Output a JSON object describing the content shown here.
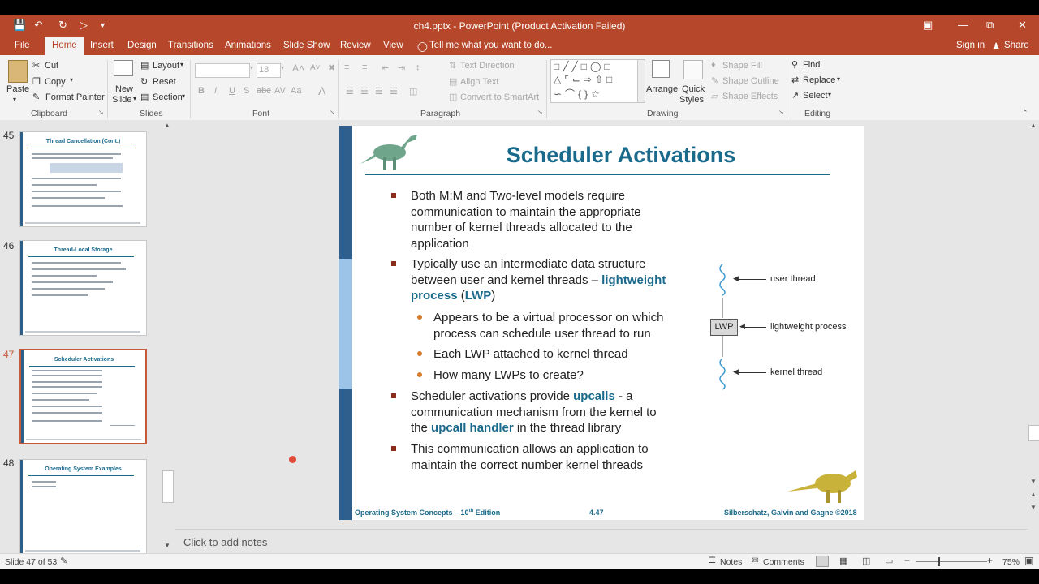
{
  "window": {
    "title": "ch4.pptx - PowerPoint (Product Activation Failed)",
    "signin": "Sign in",
    "share": "Share"
  },
  "tabs": [
    "File",
    "Home",
    "Insert",
    "Design",
    "Transitions",
    "Animations",
    "Slide Show",
    "Review",
    "View"
  ],
  "tell_me": "Tell me what you want to do...",
  "ribbon": {
    "clipboard": {
      "paste": "Paste",
      "cut": "Cut",
      "copy": "Copy",
      "format_painter": "Format Painter",
      "group": "Clipboard"
    },
    "slides": {
      "new_slide": "New",
      "new_slide2": "Slide",
      "layout": "Layout",
      "reset": "Reset",
      "section": "Section",
      "group": "Slides"
    },
    "font": {
      "size": "18",
      "group": "Font",
      "bold": "B",
      "italic": "I",
      "underline": "U",
      "strike": "S",
      "shadow": "abc",
      "spacing": "AV",
      "case": "Aa",
      "color": "A"
    },
    "paragraph": {
      "text_direction": "Text Direction",
      "align_text": "Align Text",
      "convert": "Convert to SmartArt",
      "group": "Paragraph"
    },
    "drawing": {
      "arrange": "Arrange",
      "quick": "Quick",
      "styles": "Styles",
      "shape_fill": "Shape Fill",
      "shape_outline": "Shape Outline",
      "shape_effects": "Shape Effects",
      "group": "Drawing"
    },
    "editing": {
      "find": "Find",
      "replace": "Replace",
      "select": "Select",
      "group": "Editing"
    }
  },
  "thumbnails": [
    {
      "num": "45",
      "title": "Thread Cancellation (Cont.)"
    },
    {
      "num": "46",
      "title": "Thread-Local Storage"
    },
    {
      "num": "47",
      "title": "Scheduler Activations"
    },
    {
      "num": "48",
      "title": "Operating System Examples"
    }
  ],
  "slide": {
    "title": "Scheduler Activations",
    "b1": [
      "Both M:M and Two-level models require",
      "communication to maintain the appropriate",
      "number of kernel threads allocated to the",
      "application"
    ],
    "b2_l1": "Typically use an intermediate data structure",
    "b2_l2a": "between user and kernel threads – ",
    "b2_l2b": "lightweight",
    "b2_l3a": "process",
    "b2_l3b": " (",
    "b2_l3c": "LWP",
    "b2_l3d": ")",
    "s1": [
      "Appears to be a virtual processor on which",
      "process can schedule user thread to run"
    ],
    "s2": "Each LWP attached to kernel thread",
    "s3": "How many LWPs to create?",
    "b3_l1a": "Scheduler activations provide ",
    "b3_l1b": "upcalls",
    "b3_l1c": " - a",
    "b3_l2": "communication mechanism from the kernel to",
    "b3_l3a": "the ",
    "b3_l3b": "upcall handler",
    "b3_l3c": " in the thread library",
    "b4": [
      "This communication allows an application to",
      "maintain the correct number kernel threads"
    ],
    "diagram": {
      "user_thread": "user thread",
      "lwp": "LWP",
      "lightweight_process": "lightweight process",
      "kernel_thread": "kernel thread"
    },
    "footer_left": "Operating System Concepts – 10",
    "footer_sup": "th",
    "footer_left2": " Edition",
    "footer_mid": "4.47",
    "footer_right": "Silberschatz, Galvin and Gagne ©2018"
  },
  "notes_placeholder": "Click to add notes",
  "status": {
    "slide_of": "Slide 47 of 53",
    "notes": "Notes",
    "comments": "Comments",
    "zoom": "75%"
  }
}
